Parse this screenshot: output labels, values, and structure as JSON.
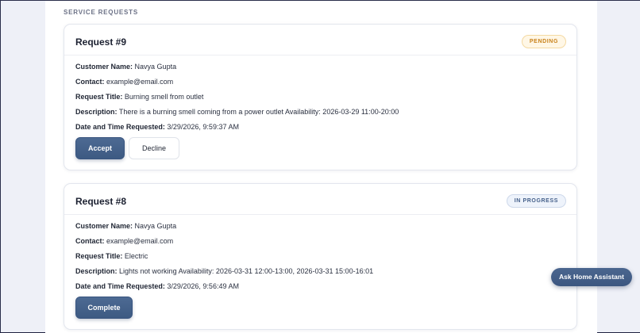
{
  "section": {
    "title": "SERVICE REQUESTS"
  },
  "labels": {
    "customer_name": "Customer Name:",
    "contact": "Contact:",
    "request_title": "Request Title:",
    "description": "Description:",
    "date_requested": "Date and Time Requested:"
  },
  "requests": [
    {
      "title": "Request #9",
      "status": "PENDING",
      "customer_name": "Navya Gupta",
      "contact": "example@email.com",
      "request_title": "Burning smell from outlet",
      "description": "There is a burning smell coming from a power outlet Availability: 2026-03-29 11:00-20:00",
      "date_requested": "3/29/2026, 9:59:37 AM",
      "actions": {
        "accept": "Accept",
        "decline": "Decline"
      }
    },
    {
      "title": "Request #8",
      "status": "IN PROGRESS",
      "customer_name": "Navya Gupta",
      "contact": "example@email.com",
      "request_title": "Electric",
      "description": "Lights not working Availability: 2026-03-31 12:00-13:00, 2026-03-31 15:00-16:01",
      "date_requested": "3/29/2026, 9:56:49 AM",
      "actions": {
        "complete": "Complete"
      }
    }
  ],
  "assistant": {
    "label": "Ask Home Assistant"
  },
  "colors": {
    "primary": "#3d5a82",
    "pending_text": "#c9821b",
    "progress_text": "#45608a",
    "background": "#eef0f7"
  }
}
